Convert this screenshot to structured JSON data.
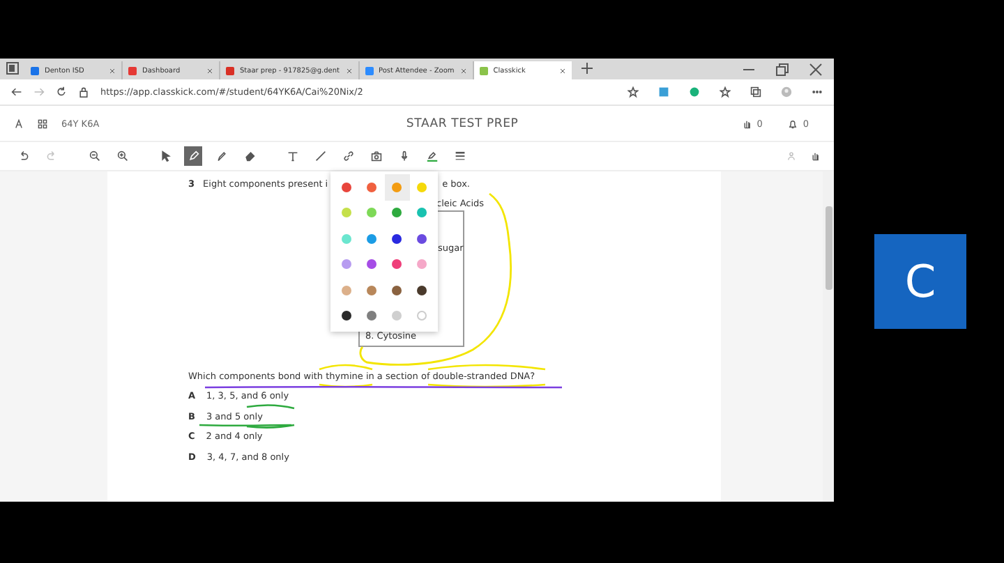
{
  "browser": {
    "tabs": [
      {
        "title": "Denton ISD",
        "selected": false,
        "color": "#1a73e8"
      },
      {
        "title": "Dashboard",
        "selected": false,
        "color": "#e53935"
      },
      {
        "title": "Staar prep - 917825@g.dent",
        "selected": false,
        "color": "#d93025"
      },
      {
        "title": "Post Attendee - Zoom",
        "selected": false,
        "color": "#2d8cff"
      },
      {
        "title": "Classkick",
        "selected": true,
        "color": "#8bc34a"
      }
    ],
    "address": "https://app.classkick.com/#/student/64YK6A/Cai%20Nix/2"
  },
  "app": {
    "code": "64Y K6A",
    "title": "STAAR TEST PREP",
    "raised_hands": "0",
    "notifications": "0"
  },
  "toolbar": {
    "tools": [
      {
        "kind": "undo",
        "selected": false,
        "disabled": false
      },
      {
        "kind": "redo",
        "selected": false,
        "disabled": true
      },
      {
        "kind": "zoom-out",
        "selected": false,
        "disabled": false
      },
      {
        "kind": "zoom-in",
        "selected": false,
        "disabled": false
      },
      {
        "kind": "pointer",
        "selected": false,
        "disabled": false
      },
      {
        "kind": "pen",
        "selected": true,
        "disabled": false
      },
      {
        "kind": "highlighter",
        "selected": false,
        "disabled": false
      },
      {
        "kind": "eraser",
        "selected": false,
        "disabled": false
      },
      {
        "kind": "text",
        "selected": false,
        "disabled": false
      },
      {
        "kind": "line",
        "selected": false,
        "disabled": false
      },
      {
        "kind": "link",
        "selected": false,
        "disabled": false
      },
      {
        "kind": "camera",
        "selected": false,
        "disabled": false
      },
      {
        "kind": "microphone",
        "selected": false,
        "disabled": false
      },
      {
        "kind": "pen-color",
        "selected": false,
        "disabled": false
      },
      {
        "kind": "line-weight",
        "selected": false,
        "disabled": false
      }
    ]
  },
  "question": {
    "number": "3",
    "intro_start": "Eight components present i",
    "intro_end": "e box.",
    "box_heading": "cleic Acids",
    "box_items": [
      "sugar",
      "8.  Cytosine"
    ],
    "prompt": "Which components bond with thymine in a section of double-stranded DNA?",
    "options": [
      {
        "letter": "A",
        "text": "1, 3, 5, and 6 only"
      },
      {
        "letter": "B",
        "text": "3 and 5 only"
      },
      {
        "letter": "C",
        "text": "2 and 4 only"
      },
      {
        "letter": "D",
        "text": "3, 4, 7, and 8 only"
      }
    ]
  },
  "color_palette": {
    "colors": [
      {
        "color": "#e8453c",
        "selected": false
      },
      {
        "color": "#f0603f",
        "selected": false
      },
      {
        "color": "#f39c12",
        "selected": true
      },
      {
        "color": "#f5d90a",
        "selected": false
      },
      {
        "color": "#c5e04a",
        "selected": false
      },
      {
        "color": "#7ed957",
        "selected": false
      },
      {
        "color": "#2eaa3f",
        "selected": false
      },
      {
        "color": "#19c2b0",
        "selected": false
      },
      {
        "color": "#6be6cf",
        "selected": false
      },
      {
        "color": "#1b9ce5",
        "selected": false
      },
      {
        "color": "#2a2ae0",
        "selected": false
      },
      {
        "color": "#6a4be0",
        "selected": false
      },
      {
        "color": "#b79cf0",
        "selected": false
      },
      {
        "color": "#a64de6",
        "selected": false
      },
      {
        "color": "#ef3f7a",
        "selected": false
      },
      {
        "color": "#f5a8c8",
        "selected": false
      },
      {
        "color": "#dcb08a",
        "selected": false
      },
      {
        "color": "#b8875a",
        "selected": false
      },
      {
        "color": "#8a6240",
        "selected": false
      },
      {
        "color": "#4a3a2c",
        "selected": false
      },
      {
        "color": "#2a2a2a",
        "selected": false
      },
      {
        "color": "#7f7f7f",
        "selected": false
      },
      {
        "color": "#cfcfcf",
        "selected": false
      },
      {
        "color": "#ffffff",
        "selected": false
      }
    ]
  },
  "participant": {
    "initial": "C"
  }
}
